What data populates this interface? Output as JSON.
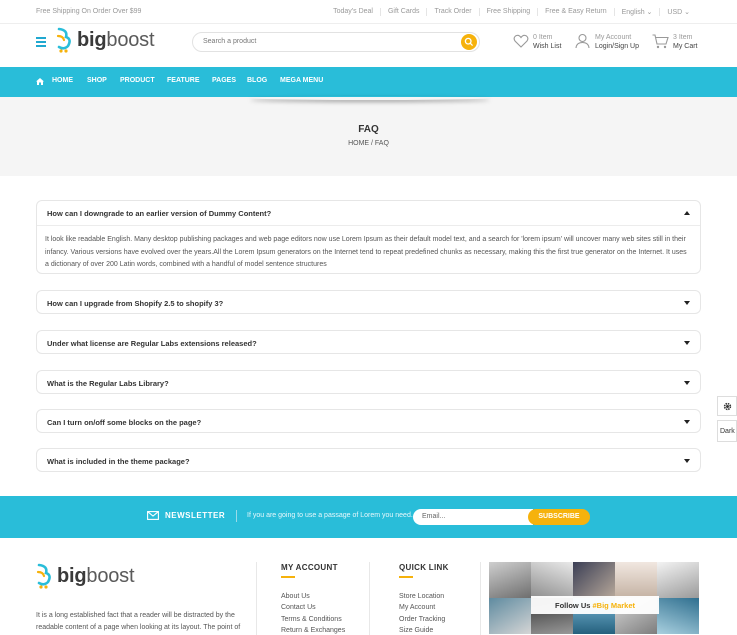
{
  "topbar": {
    "shipping": "Free Shipping On Order Over $99",
    "links": [
      "Today's Deal",
      "Gift Cards",
      "Track Order",
      "Free Shipping",
      "Free & Easy Return",
      "English ⌄",
      "USD ⌄"
    ]
  },
  "header": {
    "logo_b": "big",
    "logo_rest": "boost",
    "search_placeholder": "Search a product",
    "wishlist": {
      "count": "0 Item",
      "label": "Wish List"
    },
    "account": {
      "top": "My Account",
      "label": "Login/Sign Up"
    },
    "cart": {
      "count": "3 Item",
      "label": "My Cart"
    }
  },
  "nav": {
    "items": [
      "HOME",
      "SHOP",
      "PRODUCT",
      "FEATURE",
      "PAGES",
      "BLOG",
      "MEGA MENU"
    ]
  },
  "breadcrumb": {
    "title": "FAQ",
    "path": "HOME  /  FAQ"
  },
  "faq": [
    {
      "q": "How can I downgrade to an earlier version of Dummy Content?",
      "a": "It look like readable English. Many desktop publishing packages and web page editors now use Lorem Ipsum as their default model text, and a search for 'lorem ipsum' will uncover many web sites still in their infancy. Various versions have evolved over the years.All the Lorem Ipsum generators on the Internet tend to repeat predefined chunks as necessary, making this the first true generator on the Internet. It uses a dictionary of over 200 Latin words, combined with a handful of model sentence structures"
    },
    {
      "q": "How can I upgrade from Shopify 2.5 to shopify 3?"
    },
    {
      "q": "Under what license are Regular Labs extensions released?"
    },
    {
      "q": "What is the Regular Labs Library?"
    },
    {
      "q": "Can I turn on/off some blocks on the page?"
    },
    {
      "q": "What is included in the theme package?"
    }
  ],
  "side_widget": {
    "dark_label": "Dark"
  },
  "newsletter": {
    "label": "NEWSLETTER",
    "desc": "If you are going to use a passage of Lorem you need.",
    "email_placeholder": "Email...",
    "button": "SUBSCRIBE"
  },
  "footer": {
    "desc": "It is a long established fact that a reader will be distracted by the readable content of a page when looking at its layout. The point of",
    "account_title": "MY ACCOUNT",
    "account_links": [
      "About Us",
      "Contact Us",
      "Terms & Conditions",
      "Return & Exchanges"
    ],
    "quick_title": "QUICK LINK",
    "quick_links": [
      "Store Location",
      "My Account",
      "Order Tracking",
      "Size Guide"
    ],
    "follow_text": "Follow Us",
    "follow_tag": "#Big Market"
  },
  "colors": {
    "accent": "#29bdd9",
    "highlight": "#f6b20c"
  }
}
